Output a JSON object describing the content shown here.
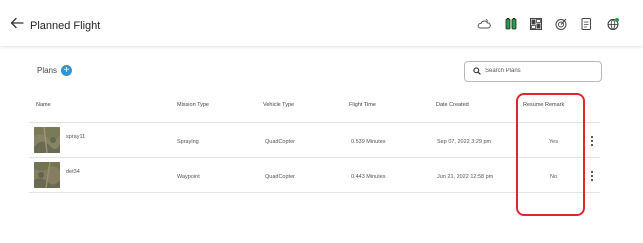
{
  "header": {
    "title": "Planned Flight",
    "icons": [
      "weather-icon",
      "battery-icon",
      "dashboard-icon",
      "target-icon",
      "document-icon",
      "globe-icon"
    ]
  },
  "plans": {
    "label": "Plans",
    "add_symbol": "+"
  },
  "search": {
    "placeholder": "Search Plans"
  },
  "table": {
    "columns": [
      "Name",
      "Mission Type",
      "Vehicle Type",
      "Flight Time",
      "Date Created",
      "Resume Remark"
    ],
    "rows": [
      {
        "name": "spray11",
        "mission_type": "Spraying",
        "vehicle_type": "QuadCopter",
        "flight_time": "0.539 Minutes",
        "date_created": "Sep 07, 2022  3:29 pm",
        "resume_remark": "Yes"
      },
      {
        "name": "det34",
        "mission_type": "Waypoint",
        "vehicle_type": "QuadCopter",
        "flight_time": "0.443 Minutes",
        "date_created": "Jun 21, 2022  12:58 pm",
        "resume_remark": "No"
      }
    ]
  },
  "colors": {
    "accent": "#2f96d6",
    "highlight": "#e0262c",
    "icon_green": "#2e9b4a"
  }
}
